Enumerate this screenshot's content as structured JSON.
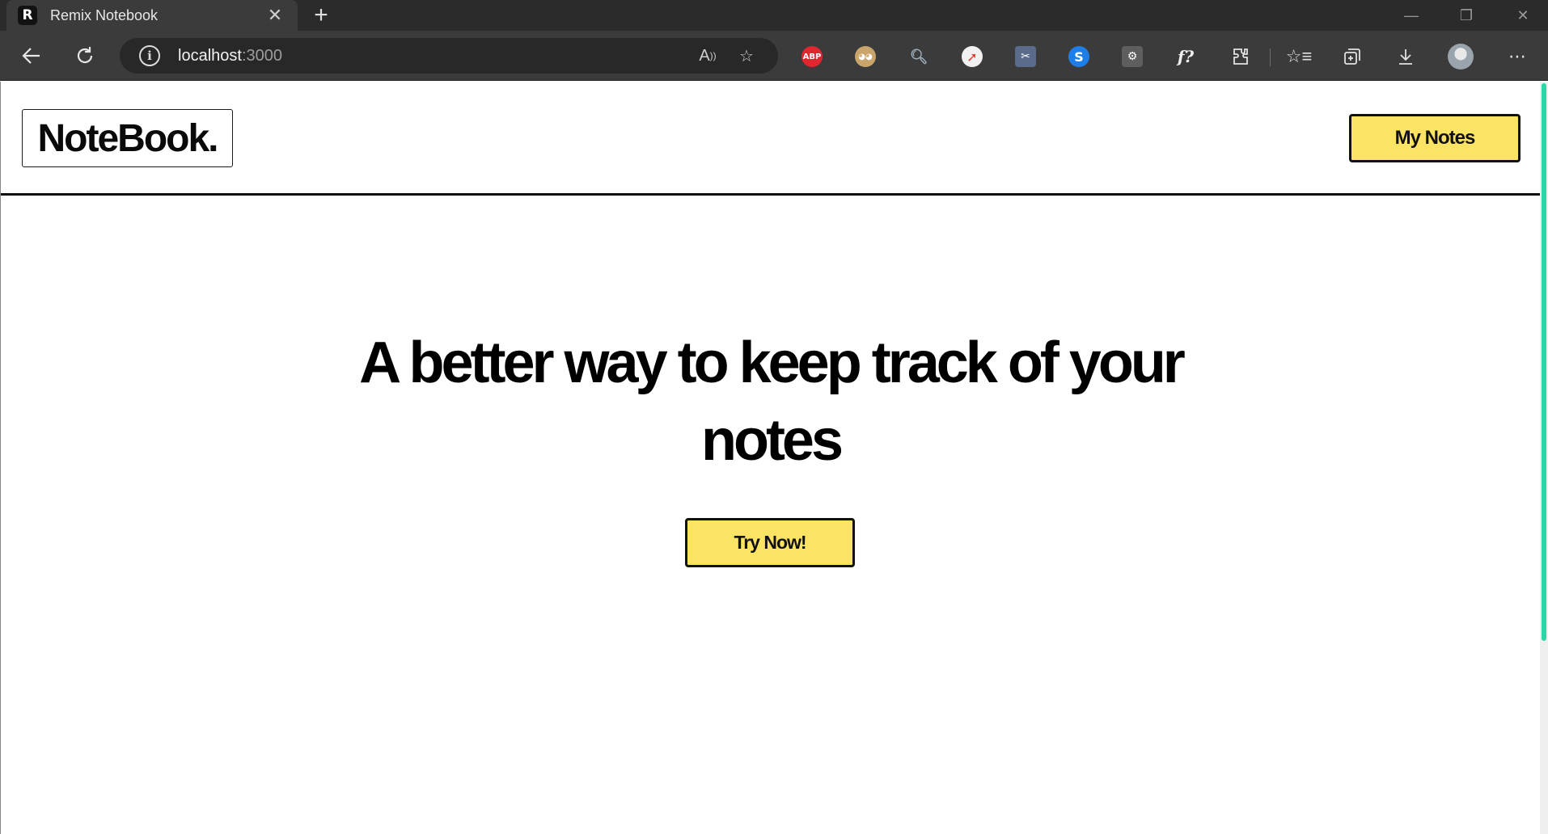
{
  "browser": {
    "tab": {
      "title": "Remix Notebook",
      "favicon_letter": "R"
    },
    "address": {
      "host": "localhost",
      "port": ":3000"
    },
    "extensions": [
      {
        "name": "adblock-icon",
        "label": "ABP",
        "color": "#e0262e"
      },
      {
        "name": "owl-icon",
        "label": "",
        "color": "#c9a46b"
      },
      {
        "name": "magnifier-icon",
        "label": "",
        "color": "#7a8a96"
      },
      {
        "name": "rocket-icon",
        "label": "",
        "color": "#f1f1f1"
      },
      {
        "name": "clip-icon",
        "label": "",
        "color": "#d43b3b"
      },
      {
        "name": "shazam-icon",
        "label": "",
        "color": "#1e7ee8"
      },
      {
        "name": "gear-box-icon",
        "label": "",
        "color": "#6b6b6b"
      },
      {
        "name": "font-icon",
        "label": "f?",
        "color": "#3b3b3b"
      }
    ]
  },
  "page": {
    "logo": "NoteBook.",
    "nav_button": "My Notes",
    "headline": "A better way to keep track of your notes",
    "cta": "Try Now!",
    "accent_color": "#fbe364"
  }
}
